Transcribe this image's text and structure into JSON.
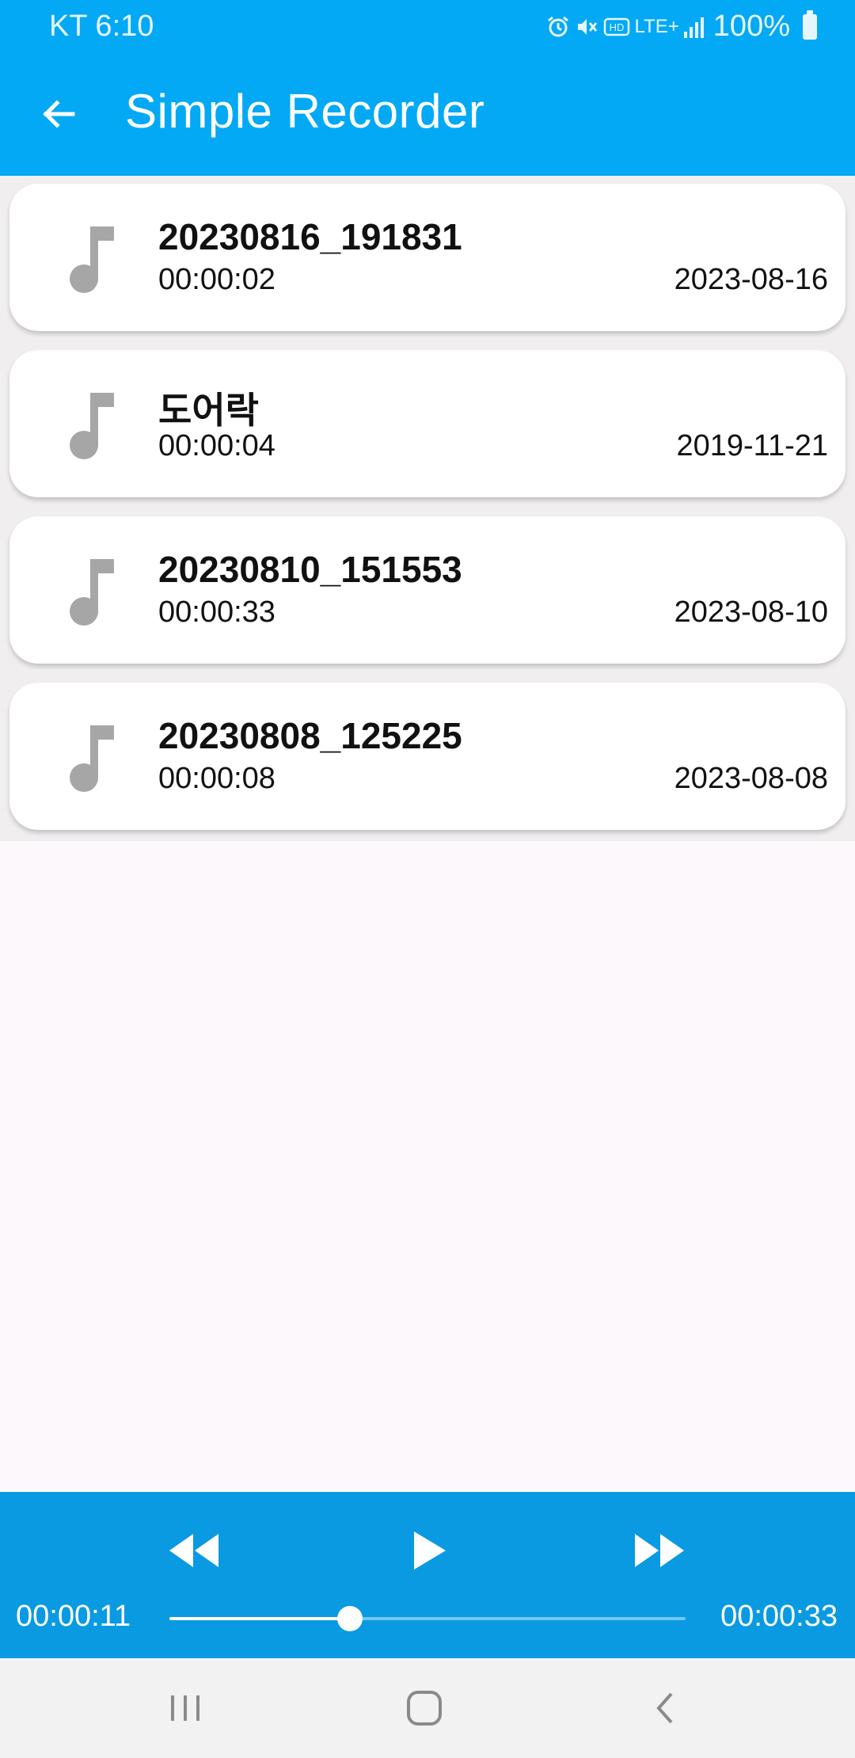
{
  "status_bar": {
    "carrier_time": "KT 6:10",
    "network": "LTE+",
    "battery": "100%",
    "icons": [
      "alarm-icon",
      "mute-icon",
      "hd-icon",
      "lte-icon",
      "signal-icon",
      "battery-icon"
    ]
  },
  "app_bar": {
    "title": "Simple Recorder",
    "back_icon": "arrow-left-icon"
  },
  "recordings": [
    {
      "title": "20230816_191831",
      "duration": "00:00:02",
      "date": "2023-08-16"
    },
    {
      "title": "도어락",
      "duration": "00:00:04",
      "date": "2019-11-21"
    },
    {
      "title": "20230810_151553",
      "duration": "00:00:33",
      "date": "2023-08-10"
    },
    {
      "title": "20230808_125225",
      "duration": "00:00:08",
      "date": "2023-08-08"
    }
  ],
  "player": {
    "current_time": "00:00:11",
    "total_time": "00:00:33",
    "progress": 0.35,
    "controls": [
      "rewind-icon",
      "play-icon",
      "fast-forward-icon"
    ]
  },
  "colors": {
    "primary": "#03a9f4",
    "player": "#0a9ae2",
    "note_icon": "#a6a6a6",
    "background": "#fdf8fc"
  }
}
